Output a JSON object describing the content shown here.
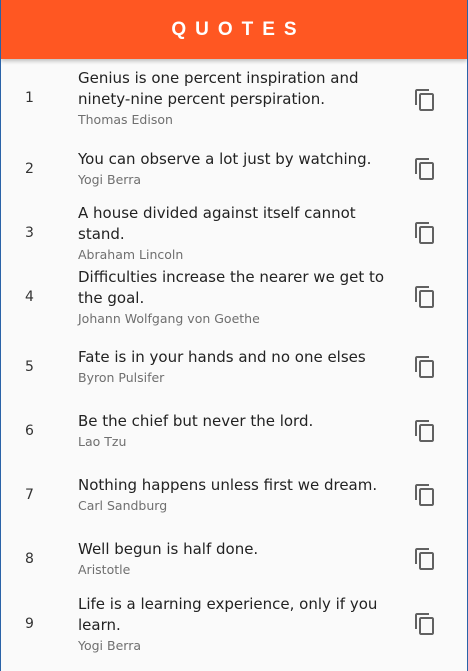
{
  "app": {
    "title": "QUOTES",
    "accent_color": "#ff5722"
  },
  "icons": {
    "copy": "content-copy-icon"
  },
  "quotes": [
    {
      "index": "1",
      "text": "Genius is one percent inspiration and ninety-nine percent perspiration.",
      "author": "Thomas Edison"
    },
    {
      "index": "2",
      "text": "You can observe a lot just by watching.",
      "author": "Yogi Berra"
    },
    {
      "index": "3",
      "text": "A house divided against itself cannot stand.",
      "author": "Abraham Lincoln"
    },
    {
      "index": "4",
      "text": "Difficulties increase the nearer we get to the goal.",
      "author": "Johann Wolfgang von Goethe"
    },
    {
      "index": "5",
      "text": "Fate is in your hands and no one elses",
      "author": "Byron Pulsifer"
    },
    {
      "index": "6",
      "text": "Be the chief but never the lord.",
      "author": "Lao Tzu"
    },
    {
      "index": "7",
      "text": "Nothing happens unless first we dream.",
      "author": "Carl Sandburg"
    },
    {
      "index": "8",
      "text": "Well begun is half done.",
      "author": "Aristotle"
    },
    {
      "index": "9",
      "text": "Life is a learning experience, only if you learn.",
      "author": "Yogi Berra"
    }
  ]
}
